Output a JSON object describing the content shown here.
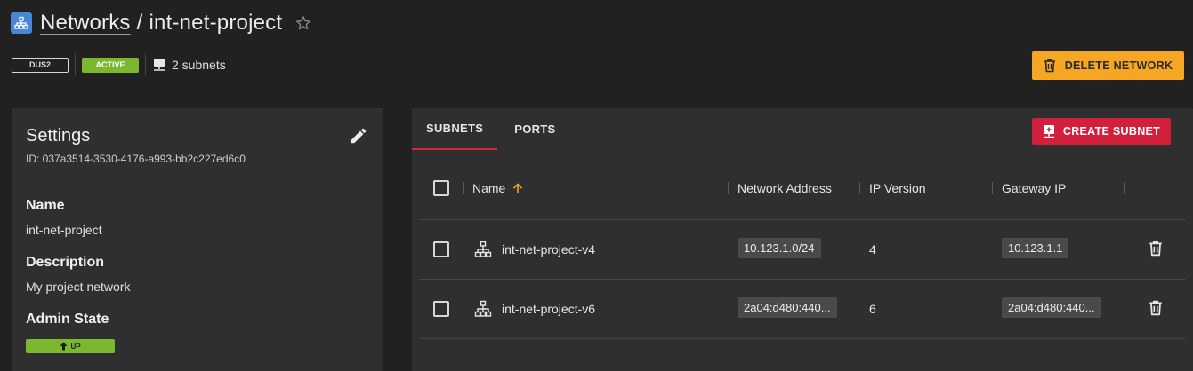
{
  "header": {
    "breadcrumb_parent": "Networks",
    "separator": "/",
    "network_name": "int-net-project",
    "icon": "network-icon",
    "favorite_icon": "star-outline-icon"
  },
  "meta": {
    "region": "DUS2",
    "status": "ACTIVE",
    "subnets_count": "2 subnets"
  },
  "actions": {
    "delete_network": "DELETE NETWORK"
  },
  "settings": {
    "title": "Settings",
    "id_line": "ID: 037a3514-3530-4176-a993-bb2c227ed6c0",
    "name_label": "Name",
    "name_value": "int-net-project",
    "description_label": "Description",
    "description_value": "My project network",
    "admin_state_label": "Admin State",
    "admin_state_value": "UP"
  },
  "tabs": [
    {
      "label": "SUBNETS",
      "active": true
    },
    {
      "label": "PORTS",
      "active": false
    }
  ],
  "create_subnet": "CREATE SUBNET",
  "table": {
    "columns": [
      "Name",
      "Network Address",
      "IP Version",
      "Gateway IP"
    ],
    "sort_column": "Name",
    "sort_direction": "ascending",
    "rows": [
      {
        "name": "int-net-project-v4",
        "network_address": "10.123.1.0/24",
        "ip_version": "4",
        "gateway_ip": "10.123.1.1"
      },
      {
        "name": "int-net-project-v6",
        "network_address": "2a04:d480:440...",
        "ip_version": "6",
        "gateway_ip": "2a04:d480:440..."
      }
    ]
  },
  "colors": {
    "background": "#212121",
    "card": "#2f2f2f",
    "accent_orange": "#f5a623",
    "accent_red": "#d21f3c",
    "status_green": "#7cb82f",
    "network_icon_blue": "#4a86d6"
  }
}
